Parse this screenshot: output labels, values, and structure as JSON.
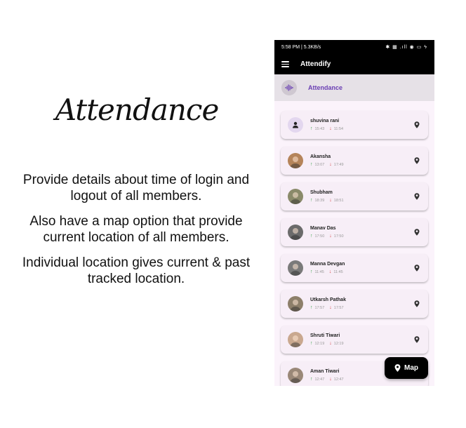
{
  "promo": {
    "title": "Attendance",
    "paragraph1": "Provide details about time of login and logout of all members.",
    "paragraph2": "Also have a map option that provide current location of all members.",
    "paragraph3": "Individual location gives current & past tracked location."
  },
  "status_bar": {
    "left": "5:58 PM | 5.3KB/s",
    "right": "✱ ▦ .ıll ◉ ▭ ϟ"
  },
  "app_bar": {
    "title": "Attendify"
  },
  "section": {
    "label": "Attendance"
  },
  "members": [
    {
      "name": "shuvina rani",
      "login": "15:43",
      "logout": "11:54",
      "avatar_color": "#e3d7ef"
    },
    {
      "name": "Akansha",
      "login": "13:07",
      "logout": "17:49",
      "avatar_color": "#b5845a"
    },
    {
      "name": "Shubham",
      "login": "18:39",
      "logout": "18:51",
      "avatar_color": "#8a8a6a"
    },
    {
      "name": "Manav Das",
      "login": "17:50",
      "logout": "17:50",
      "avatar_color": "#6b6b6b"
    },
    {
      "name": "Manna Devgan",
      "login": "11:45",
      "logout": "11:45",
      "avatar_color": "#7a7a7a"
    },
    {
      "name": "Utkarsh Pathak",
      "login": "17:57",
      "logout": "17:57",
      "avatar_color": "#8d7f6a"
    },
    {
      "name": "Shruti Tiwari",
      "login": "12:19",
      "logout": "12:19",
      "avatar_color": "#c9a88f"
    },
    {
      "name": "Aman Tiwari",
      "login": "12:47",
      "logout": "12:47",
      "avatar_color": "#9a8878"
    }
  ],
  "map_button": {
    "label": "Map"
  },
  "colors": {
    "accent": "#6a3fb3",
    "card": "#f7eef7",
    "login_arrow": "#2e9c3f",
    "logout_arrow": "#d23a3a"
  }
}
